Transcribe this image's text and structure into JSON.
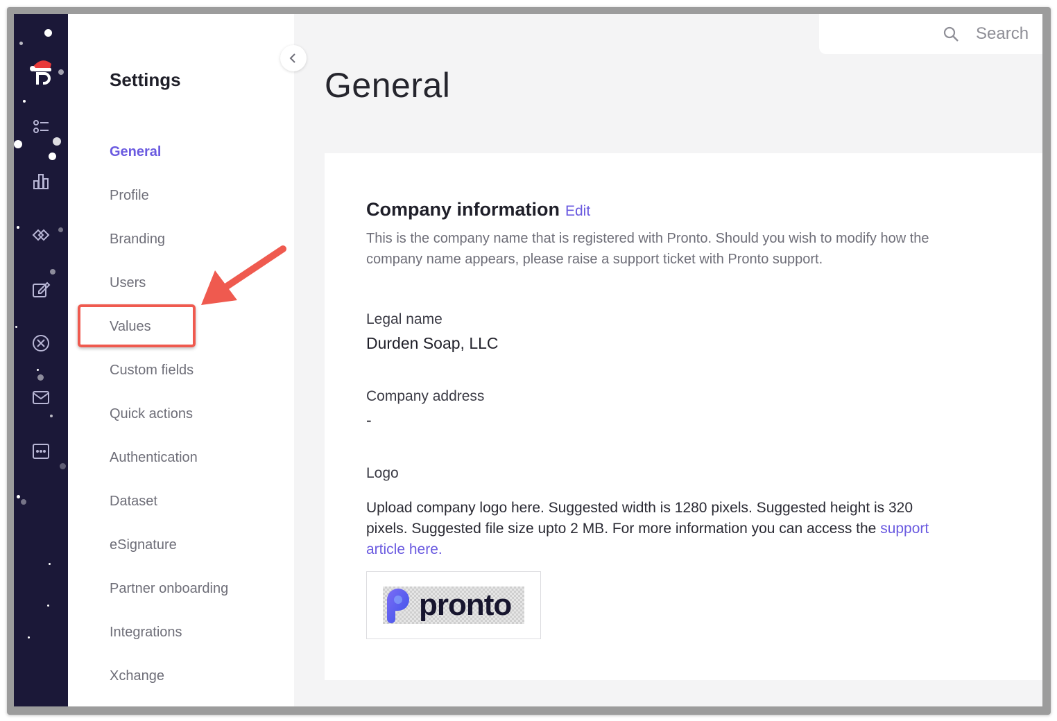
{
  "sidebar": {
    "title": "Settings",
    "items": [
      {
        "label": "General",
        "active": true
      },
      {
        "label": "Profile"
      },
      {
        "label": "Branding"
      },
      {
        "label": "Users"
      },
      {
        "label": "Values"
      },
      {
        "label": "Custom fields"
      },
      {
        "label": "Quick actions"
      },
      {
        "label": "Authentication"
      },
      {
        "label": "Dataset"
      },
      {
        "label": "eSignature"
      },
      {
        "label": "Partner onboarding"
      },
      {
        "label": "Integrations"
      },
      {
        "label": "Xchange"
      }
    ]
  },
  "rail": {
    "icons": [
      "pronto-logo-icon",
      "tasks-icon",
      "analytics-icon",
      "integrations-icon",
      "edit-icon",
      "cancel-icon",
      "mail-icon",
      "chat-icon"
    ]
  },
  "search": {
    "placeholder": "Search"
  },
  "page": {
    "title": "General"
  },
  "company": {
    "section_title": "Company information",
    "edit_label": "Edit",
    "description": "This is the company name that is registered with Pronto. Should you wish to modify how the company name appears, please raise a support ticket with Pronto support.",
    "legal_name_label": "Legal name",
    "legal_name_value": "Durden Soap, LLC",
    "address_label": "Company address",
    "address_value": "-",
    "logo_label": "Logo",
    "logo_description": "Upload company logo here. Suggested width is 1280 pixels. Suggested height is 320 pixels. Suggested file size upto 2 MB. For more information you can access the ",
    "logo_link": "support article here.",
    "logo_wordmark": "pronto"
  },
  "colors": {
    "accent": "#6a5ae0",
    "rail_bg": "#1b1838",
    "annotation": "#ef5a4f"
  }
}
